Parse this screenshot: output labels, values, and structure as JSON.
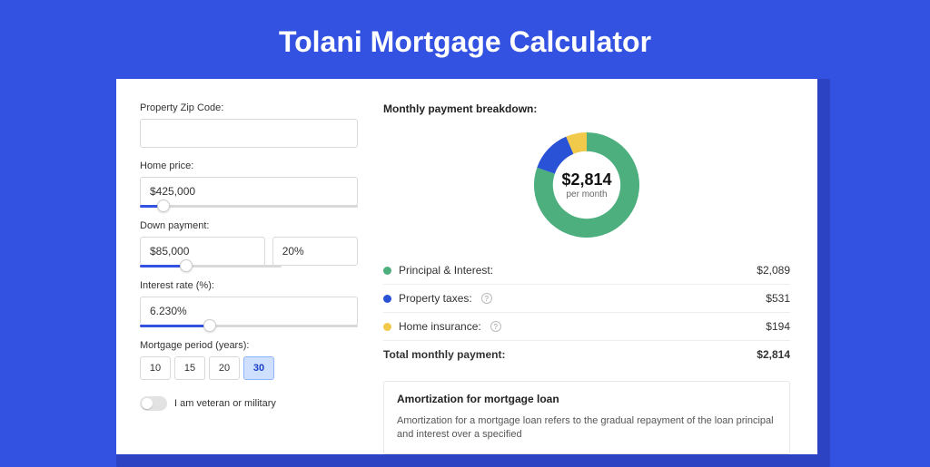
{
  "title": "Tolani Mortgage Calculator",
  "form": {
    "zip_label": "Property Zip Code:",
    "zip_value": "",
    "home_price_label": "Home price:",
    "home_price_value": "$425,000",
    "down_payment_label": "Down payment:",
    "down_payment_value": "$85,000",
    "down_payment_pct": "20%",
    "interest_label": "Interest rate (%):",
    "interest_value": "6.230%",
    "period_label": "Mortgage period (years):",
    "periods": [
      "10",
      "15",
      "20",
      "30"
    ],
    "period_selected": "30",
    "veteran_label": "I am veteran or military"
  },
  "breakdown": {
    "title": "Monthly payment breakdown:",
    "center_amount": "$2,814",
    "center_sub": "per month",
    "rows": [
      {
        "label": "Principal & Interest:",
        "value": "$2,089",
        "color": "green",
        "help": false
      },
      {
        "label": "Property taxes:",
        "value": "$531",
        "color": "blue",
        "help": true
      },
      {
        "label": "Home insurance:",
        "value": "$194",
        "color": "yellow",
        "help": true
      }
    ],
    "total_label": "Total monthly payment:",
    "total_value": "$2,814"
  },
  "amortization": {
    "title": "Amortization for mortgage loan",
    "text": "Amortization for a mortgage loan refers to the gradual repayment of the loan principal and interest over a specified"
  },
  "chart_data": {
    "type": "pie",
    "title": "Monthly payment breakdown",
    "series": [
      {
        "name": "Principal & Interest",
        "value": 2089,
        "color": "#4caf7d"
      },
      {
        "name": "Property taxes",
        "value": 531,
        "color": "#2952d6"
      },
      {
        "name": "Home insurance",
        "value": 194,
        "color": "#f1c94b"
      }
    ],
    "total": 2814,
    "inner_radius_pct": 64
  }
}
